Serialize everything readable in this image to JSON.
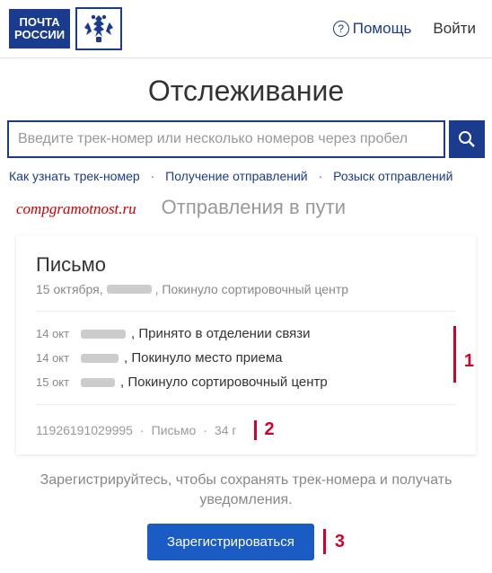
{
  "header": {
    "logo_line1": "ПОЧТА",
    "logo_line2": "РОССИИ",
    "help_label": "Помощь",
    "login_label": "Войти"
  },
  "page_title": "Отслеживание",
  "search": {
    "placeholder": "Введите трек-номер или несколько номеров через пробел"
  },
  "nav": {
    "items": [
      "Как узнать трек-номер",
      "Получение отправлений",
      "Розыск отправлений"
    ]
  },
  "watermark": "compgramotnost.ru",
  "section_title": "Отправления в пути",
  "card": {
    "title": "Письмо",
    "sub_date": "15 октября,",
    "sub_status": ", Покинуло сортировочный центр",
    "events": [
      {
        "date": "14 окт",
        "text": ", Принято в отделении связи"
      },
      {
        "date": "14 окт",
        "text": ", Покинуло место приема"
      },
      {
        "date": "15 окт",
        "text": ", Покинуло сортировочный центр"
      }
    ],
    "meta": {
      "track": "11926191029995",
      "type": "Письмо",
      "weight": "34 г"
    }
  },
  "markers": {
    "m1": "1",
    "m2": "2",
    "m3": "3"
  },
  "cta": {
    "text": "Зарегистрируйтесь, чтобы сохранять трек-номера и получать уведомления.",
    "button": "Зарегистрироваться"
  }
}
